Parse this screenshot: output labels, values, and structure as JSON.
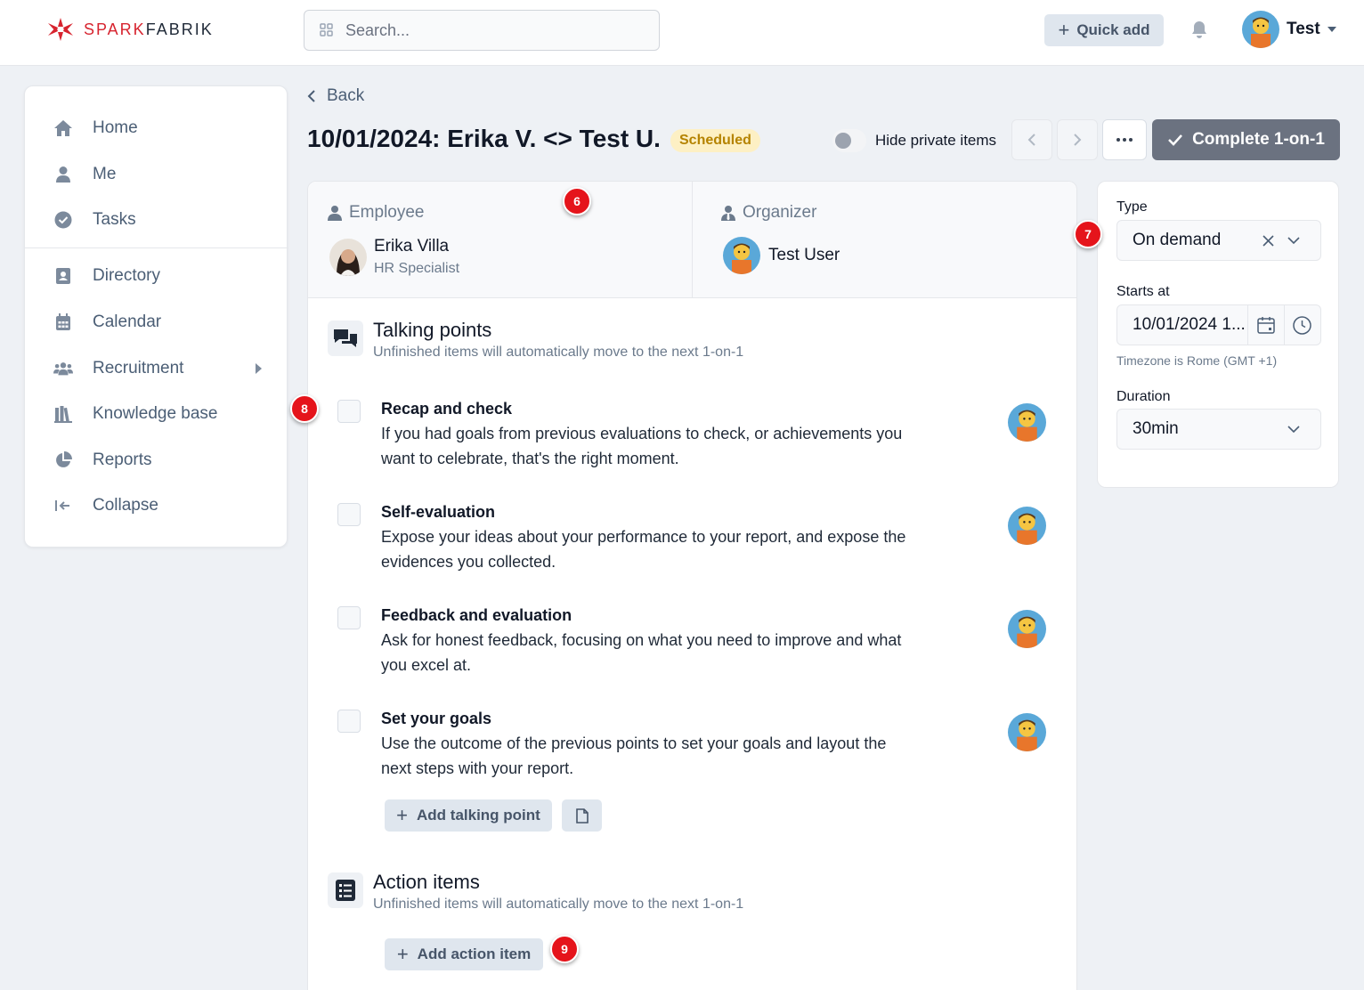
{
  "brand": {
    "logo_part1": "SPARK",
    "logo_part2": "FABRIK",
    "accent": "#d7242f"
  },
  "topbar": {
    "search_placeholder": "Search...",
    "quick_add_label": "Quick add",
    "user_name": "Test"
  },
  "sidebar": {
    "items": [
      {
        "label": "Home",
        "icon": "home-icon"
      },
      {
        "label": "Me",
        "icon": "user-icon"
      },
      {
        "label": "Tasks",
        "icon": "check-circle-icon"
      },
      {
        "label": "Directory",
        "icon": "address-book-icon"
      },
      {
        "label": "Calendar",
        "icon": "calendar-icon"
      },
      {
        "label": "Recruitment",
        "icon": "users-icon"
      },
      {
        "label": "Knowledge base",
        "icon": "book-icon"
      },
      {
        "label": "Reports",
        "icon": "pie-chart-icon"
      },
      {
        "label": "Collapse",
        "icon": "collapse-icon"
      }
    ]
  },
  "header": {
    "back_label": "Back",
    "title": "10/01/2024: Erika V. <> Test U.",
    "status": "Scheduled",
    "hide_private_label": "Hide private items",
    "complete_label": "Complete 1-on-1"
  },
  "people": {
    "employee_label": "Employee",
    "employee_name": "Erika Villa",
    "employee_role": "HR Specialist",
    "organizer_label": "Organizer",
    "organizer_name": "Test User"
  },
  "talking_points": {
    "title": "Talking points",
    "subtitle": "Unfinished items will automatically move to the next 1-on-1",
    "items": [
      {
        "title": "Recap and check",
        "desc": "If you had goals from previous evaluations to check, or achievements you want to celebrate, that's the right moment."
      },
      {
        "title": "Self-evaluation",
        "desc": "Expose your ideas about your performance to your report, and expose the evidences you collected."
      },
      {
        "title": "Feedback and evaluation",
        "desc": "Ask for honest feedback, focusing on what you need to improve and what you excel at."
      },
      {
        "title": "Set your goals",
        "desc": "Use the outcome of the previous points to set your goals and layout the next steps with your report."
      }
    ],
    "add_label": "Add talking point"
  },
  "action_items": {
    "title": "Action items",
    "subtitle": "Unfinished items will automatically move to the next 1-on-1",
    "add_label": "Add action item"
  },
  "details": {
    "type_label": "Type",
    "type_value": "On demand",
    "starts_label": "Starts at",
    "starts_value": "10/01/2024 1...",
    "timezone_note": "Timezone is Rome (GMT +1)",
    "duration_label": "Duration",
    "duration_value": "30min"
  },
  "markers": [
    "6",
    "7",
    "8",
    "9"
  ]
}
